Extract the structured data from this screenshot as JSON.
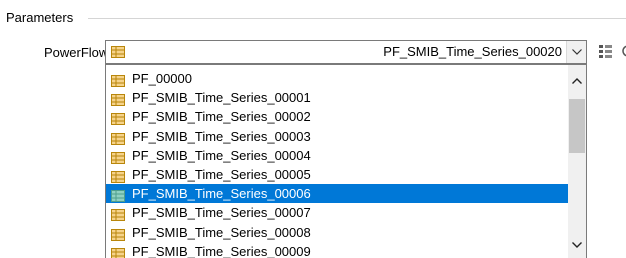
{
  "group": {
    "title": "Parameters"
  },
  "powerflow": {
    "label": "PowerFlow",
    "selected_value": "PF_SMIB_Time_Series_00020",
    "icon": "table-icon"
  },
  "dropdown": {
    "items": [
      {
        "label": "PF_00000",
        "selected": false
      },
      {
        "label": "PF_SMIB_Time_Series_00001",
        "selected": false
      },
      {
        "label": "PF_SMIB_Time_Series_00002",
        "selected": false
      },
      {
        "label": "PF_SMIB_Time_Series_00003",
        "selected": false
      },
      {
        "label": "PF_SMIB_Time_Series_00004",
        "selected": false
      },
      {
        "label": "PF_SMIB_Time_Series_00005",
        "selected": false
      },
      {
        "label": "PF_SMIB_Time_Series_00006",
        "selected": true
      },
      {
        "label": "PF_SMIB_Time_Series_00007",
        "selected": false
      },
      {
        "label": "PF_SMIB_Time_Series_00008",
        "selected": false
      },
      {
        "label": "PF_SMIB_Time_Series_00009",
        "selected": false
      }
    ]
  },
  "colors": {
    "selection": "#0078d7",
    "icon_fill": "#f6d38a",
    "icon_stroke": "#b8860b",
    "icon_selected": "#8fd1c2"
  }
}
